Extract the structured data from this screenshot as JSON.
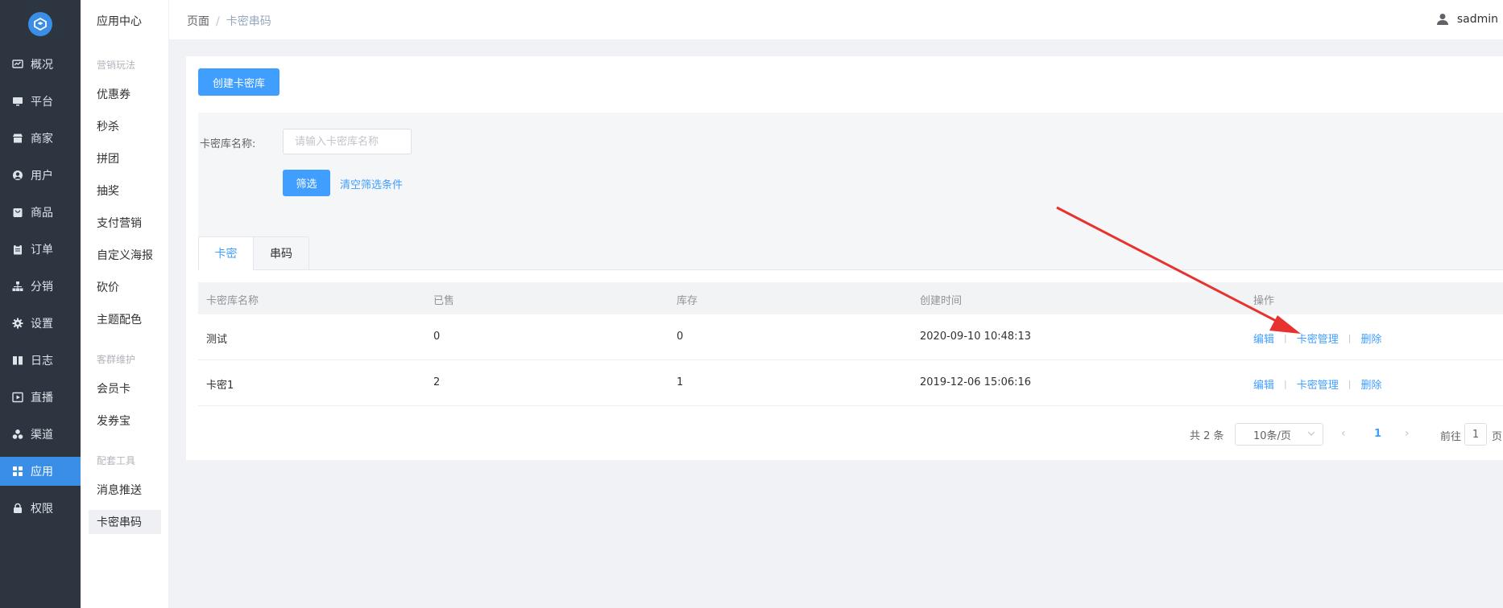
{
  "nav": {
    "items": [
      {
        "label": "概况",
        "icon": "dashboard-icon"
      },
      {
        "label": "平台",
        "icon": "monitor-icon"
      },
      {
        "label": "商家",
        "icon": "store-icon"
      },
      {
        "label": "用户",
        "icon": "user-icon"
      },
      {
        "label": "商品",
        "icon": "bag-icon"
      },
      {
        "label": "订单",
        "icon": "clipboard-icon"
      },
      {
        "label": "分销",
        "icon": "hierarchy-icon"
      },
      {
        "label": "设置",
        "icon": "gear-icon"
      },
      {
        "label": "日志",
        "icon": "book-icon"
      },
      {
        "label": "直播",
        "icon": "play-icon"
      },
      {
        "label": "渠道",
        "icon": "cluster-icon"
      },
      {
        "label": "应用",
        "icon": "apps-icon"
      },
      {
        "label": "权限",
        "icon": "lock-icon"
      }
    ],
    "active_label": "应用",
    "accent": "#3a8ee6"
  },
  "subnav": {
    "title": "应用中心",
    "groups": [
      {
        "title": "营销玩法",
        "items": [
          "优惠券",
          "秒杀",
          "拼团",
          "抽奖",
          "支付营销",
          "自定义海报",
          "砍价",
          "主题配色"
        ]
      },
      {
        "title": "客群维护",
        "items": [
          "会员卡",
          "发券宝"
        ]
      },
      {
        "title": "配套工具",
        "items": [
          "消息推送",
          "卡密串码"
        ]
      }
    ],
    "active_item": "卡密串码"
  },
  "header": {
    "breadcrumb_root": "页面",
    "breadcrumb_sep": "/",
    "breadcrumb_current": "卡密串码",
    "username": "sadmin"
  },
  "toolbar": {
    "create_label": "创建卡密库"
  },
  "filter": {
    "name_label": "卡密库名称:",
    "name_placeholder": "请输入卡密库名称",
    "name_value": "",
    "submit_label": "筛选",
    "clear_label": "清空筛选条件"
  },
  "tabs": [
    {
      "label": "卡密",
      "active": true
    },
    {
      "label": "串码",
      "active": false
    }
  ],
  "table": {
    "columns": [
      "卡密库名称",
      "已售",
      "库存",
      "创建时间",
      "操作"
    ],
    "rows": [
      {
        "name": "测试",
        "sold": "0",
        "stock": "0",
        "created": "2020-09-10 10:48:13"
      },
      {
        "name": "卡密1",
        "sold": "2",
        "stock": "1",
        "created": "2019-12-06 15:06:16"
      }
    ],
    "actions": {
      "edit": "编辑",
      "manage": "卡密管理",
      "delete": "删除",
      "sep": "|"
    }
  },
  "pagination": {
    "total_text": "共 2 条",
    "page_size": "10条/页",
    "current_page": "1",
    "goto_label": "前往",
    "goto_value": "1",
    "page_unit": "页"
  },
  "colors": {
    "primary": "#409eff",
    "sidebar_bg": "#2c3540",
    "annotation_arrow": "#e8322f"
  }
}
